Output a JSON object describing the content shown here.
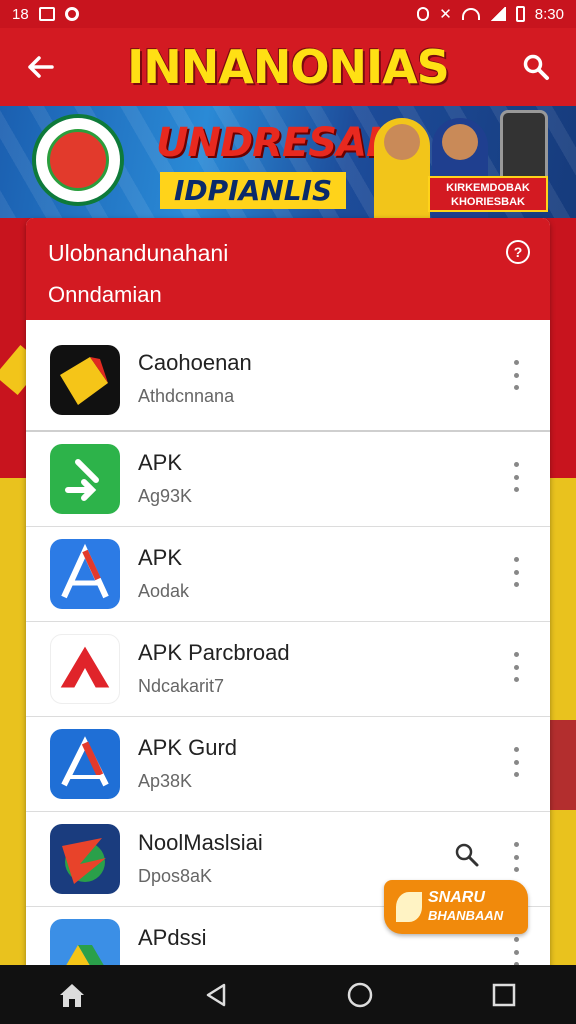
{
  "status_bar": {
    "left_text": "18",
    "time": "8:30",
    "icons": [
      "gallery-icon",
      "circle-icon",
      "nfc-icon",
      "mute-icon",
      "wifi-icon",
      "signal-icon",
      "battery-icon"
    ]
  },
  "app_bar": {
    "title": "INNANONIAS",
    "back_icon": "arrow-left-icon",
    "search_icon": "search-icon",
    "accent_color": "#d31a22",
    "title_color": "#ffe014"
  },
  "banner": {
    "headline": "UNDRESAI",
    "subheadline": "IDPIANLIS",
    "promo_line1": "KIRKEMDOBAK",
    "promo_line2": "KHORIESBAK"
  },
  "dialog": {
    "title": "Ulobnandunahani",
    "subtitle": "Onndamian",
    "help_icon": "help-circle-icon",
    "apps": [
      {
        "name": "Caohoenan",
        "detail": "Athdcnnana",
        "icon": "bolt-app-icon"
      },
      {
        "name": "APK",
        "detail": "Ag93K",
        "icon": "green-arrow-app-icon"
      },
      {
        "name": "APK",
        "detail": "Aodak",
        "icon": "blue-a-app-icon"
      },
      {
        "name": "APK Parcbroad",
        "detail": "Ndcakarit7",
        "icon": "red-a-app-icon"
      },
      {
        "name": "APK Gurd",
        "detail": "Ap38K",
        "icon": "blue-red-a-app-icon"
      },
      {
        "name": "NoolMaslsiai",
        "detail": "Dpos8aK",
        "icon": "swirl-app-icon"
      },
      {
        "name": "APdssi",
        "detail": "",
        "icon": "drive-app-icon"
      }
    ]
  },
  "corner_badge": {
    "line1": "SNARU",
    "line2": "BHANBAAN"
  },
  "nav_bar": {
    "icons": [
      "home-icon",
      "back-triangle-icon",
      "home-circle-icon",
      "recents-square-icon"
    ]
  }
}
